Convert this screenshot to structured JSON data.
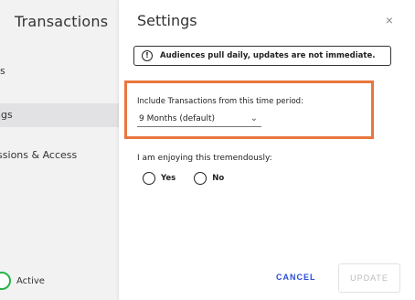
{
  "left_panel": {
    "title": "Transactions",
    "items": [
      {
        "label": "cs"
      },
      {
        "label": "ngs"
      },
      {
        "label": "issions & Access"
      }
    ],
    "status_label": "Active"
  },
  "modal": {
    "title": "Settings",
    "close_glyph": "×",
    "alert": {
      "icon_glyph": "!",
      "text": "Audiences pull daily, updates are not immediate."
    },
    "period": {
      "label": "Include Transactions from this time period:",
      "value": "9 Months (default)",
      "chevron": "⌄"
    },
    "enjoy": {
      "question": "I am enjoying this tremendously:",
      "options": [
        "Yes",
        "No"
      ]
    },
    "buttons": {
      "cancel": "CANCEL",
      "update": "UPDATE"
    }
  },
  "colors": {
    "highlight": "#e8773f",
    "cancel_text": "#2a4bd7",
    "active_green": "#29b34a"
  }
}
